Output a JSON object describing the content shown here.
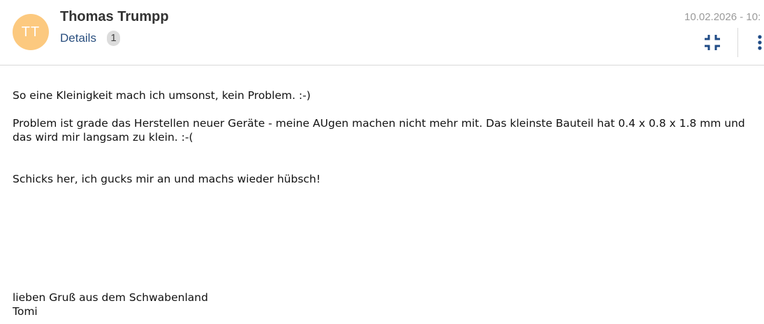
{
  "message": {
    "sender": {
      "initials": "TT",
      "name": "Thomas Trumpp",
      "avatar_color": "#fcc97f"
    },
    "details": {
      "label": "Details",
      "count": "1"
    },
    "timestamp": "10.02.2026 - 10:",
    "actions": {
      "collapse_icon": "collapse-icon",
      "more_icon": "more-vertical-icon"
    },
    "body": {
      "line1": "So eine Kleinigkeit mach ich umsonst, kein Problem. :-)",
      "line2": "Problem ist grade das Herstellen neuer Geräte - meine AUgen machen nicht mehr mit. Das kleinste Bauteil hat 0.4 x 0.8 x 1.8 mm und das wird mir langsam zu klein. :-(",
      "line3": "Schicks her, ich gucks mir an und machs wieder hübsch!",
      "closing": "lieben Gruß aus dem Schwabenland",
      "signature": "Tomi"
    }
  },
  "colors": {
    "accent": "#2a4f7f",
    "avatar": "#fcc97f"
  }
}
